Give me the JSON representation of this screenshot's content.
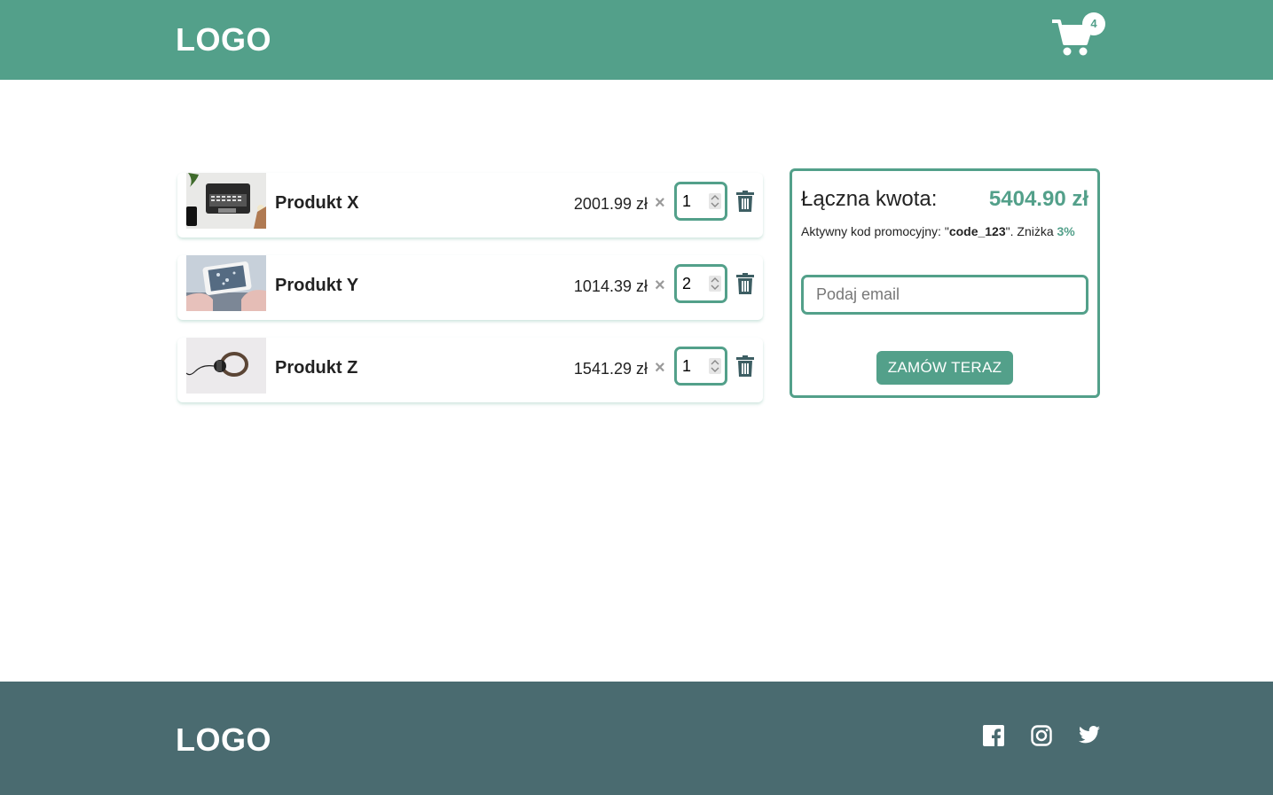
{
  "header": {
    "logo": "LOGO",
    "cart_icon": "shopping-cart-icon",
    "cart_count": "4"
  },
  "cart": {
    "items": [
      {
        "name": "Produkt X",
        "price": "2001.99 zł",
        "times": "×",
        "quantity": "1",
        "image": "laptop-photo"
      },
      {
        "name": "Produkt Y",
        "price": "1014.39 zł",
        "times": "×",
        "quantity": "2",
        "image": "phone-photo"
      },
      {
        "name": "Produkt Z",
        "price": "1541.29 zł",
        "times": "×",
        "quantity": "1",
        "image": "headphones-photo"
      }
    ]
  },
  "summary": {
    "total_label": "Łączna kwota:",
    "total_value": "5404.90 zł",
    "promo_prefix": "Aktywny kod promocyjny: \"",
    "promo_code": "code_123",
    "promo_middle": "\". Zniżka ",
    "promo_discount": "3%",
    "email_placeholder": "Podaj email",
    "email_value": "",
    "order_button": "ZAMÓW TERAZ"
  },
  "footer": {
    "logo": "LOGO",
    "social": [
      "facebook-icon",
      "instagram-icon",
      "twitter-icon"
    ]
  },
  "colors": {
    "brand": "#53a08a",
    "footer_bg": "#4a6b70",
    "icon_dark": "#3d5e63"
  }
}
